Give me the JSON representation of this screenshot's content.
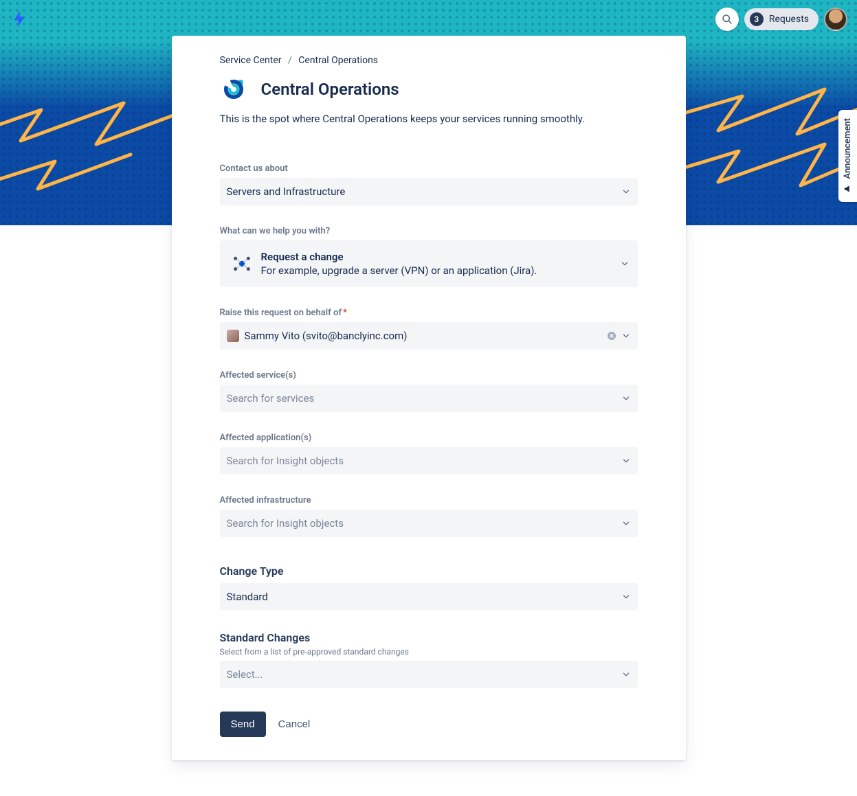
{
  "header": {
    "requests_count": "3",
    "requests_label": "Requests"
  },
  "announcement_label": "Announcement",
  "breadcrumb": {
    "root": "Service Center",
    "current": "Central Operations"
  },
  "page": {
    "title": "Central Operations",
    "intro": "This is the spot where Central Operations keeps your services running smoothly."
  },
  "fields": {
    "contact_label": "Contact us about",
    "contact_value": "Servers and Infrastructure",
    "help_label": "What can we help you with?",
    "help_title": "Request a change",
    "help_desc": "For example, upgrade a server (VPN) or an application (Jira).",
    "behalf_label": "Raise this request on behalf of",
    "behalf_value": "Sammy Vito (svito@banclyinc.com)",
    "services_label": "Affected service(s)",
    "services_placeholder": "Search for services",
    "apps_label": "Affected application(s)",
    "apps_placeholder": "Search for Insight objects",
    "infra_label": "Affected infrastructure",
    "infra_placeholder": "Search for Insight objects",
    "change_type_heading": "Change Type",
    "change_type_value": "Standard",
    "std_changes_heading": "Standard Changes",
    "std_changes_help": "Select from a list of pre-approved standard changes",
    "std_changes_placeholder": "Select..."
  },
  "actions": {
    "send": "Send",
    "cancel": "Cancel"
  }
}
